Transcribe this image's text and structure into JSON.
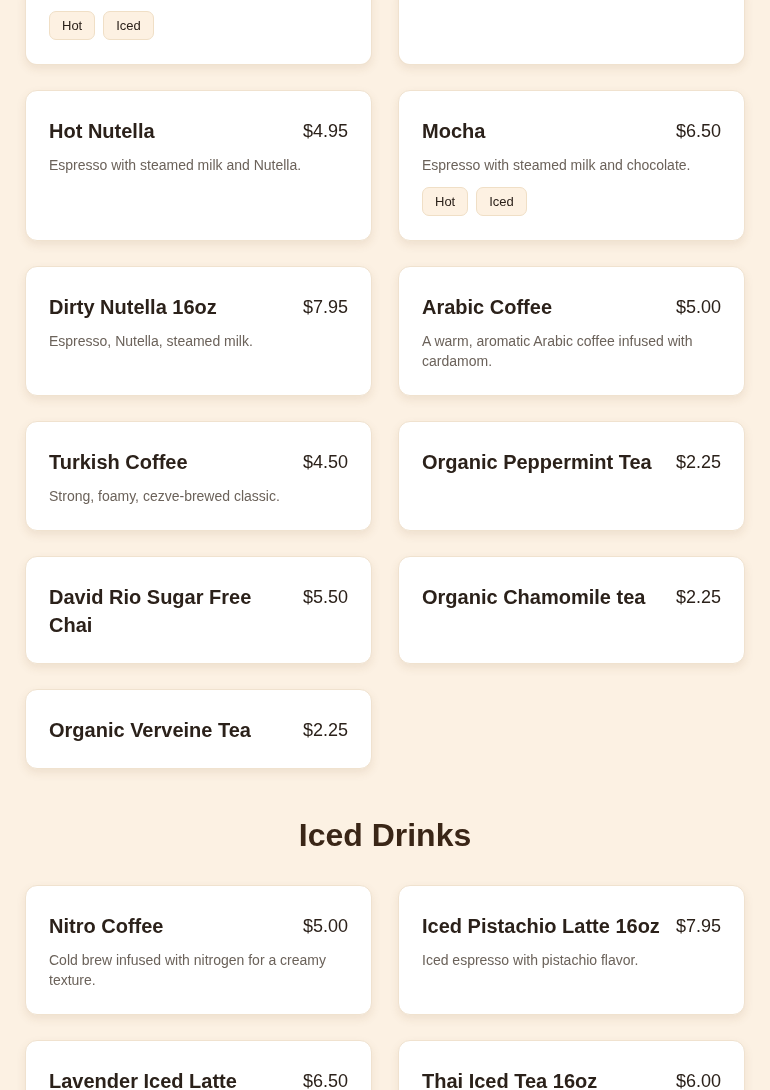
{
  "sections": [
    {
      "items": [
        {
          "kind": "cut",
          "tags": [
            "Hot",
            "Iced"
          ]
        },
        {
          "kind": "cut"
        },
        {
          "name": "Hot Nutella",
          "price": "$4.95",
          "description": "Espresso with steamed milk and Nutella."
        },
        {
          "name": "Mocha",
          "price": "$6.50",
          "description": "Espresso with steamed milk and chocolate.",
          "tags": [
            "Hot",
            "Iced"
          ]
        },
        {
          "name": "Dirty Nutella 16oz",
          "price": "$7.95",
          "description": "Espresso, Nutella, steamed milk."
        },
        {
          "name": "Arabic Coffee",
          "price": "$5.00",
          "description": "A warm, aromatic Arabic coffee infused with cardamom."
        },
        {
          "name": "Turkish Coffee",
          "price": "$4.50",
          "description": "Strong, foamy, cezve-brewed classic."
        },
        {
          "name": "Organic Peppermint Tea",
          "price": "$2.25"
        },
        {
          "name": "David Rio Sugar Free Chai",
          "price": "$5.50"
        },
        {
          "name": "Organic Chamomile tea",
          "price": "$2.25"
        },
        {
          "name": "Organic Verveine Tea",
          "price": "$2.25"
        }
      ]
    },
    {
      "title": "Iced Drinks",
      "items": [
        {
          "name": "Nitro Coffee",
          "price": "$5.00",
          "description": "Cold brew infused with nitrogen for a creamy texture."
        },
        {
          "name": "Iced Pistachio Latte 16oz",
          "price": "$7.95",
          "description": "Iced espresso with pistachio flavor."
        },
        {
          "name": "Lavender Iced Latte",
          "price": "$6.50"
        },
        {
          "name": "Thai Iced Tea 16oz",
          "price": "$6.00"
        }
      ]
    }
  ]
}
